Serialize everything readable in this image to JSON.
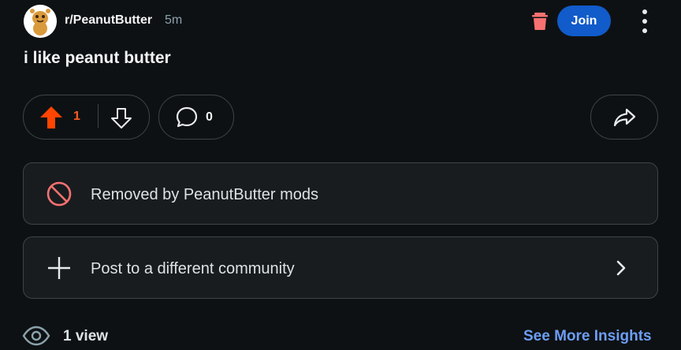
{
  "header": {
    "subreddit": "r/PeanutButter",
    "time": "5m",
    "join_label": "Join",
    "avatar_icon": "peanut-mascot-icon",
    "delete_icon": "trash-icon",
    "more_icon": "vertical-dots-icon"
  },
  "post": {
    "title": "i like peanut butter"
  },
  "actions": {
    "score": "1",
    "comments": "0",
    "upvote_icon": "upvote-arrow-icon",
    "downvote_icon": "downvote-arrow-icon",
    "comment_icon": "comment-bubble-icon",
    "share_icon": "share-arrow-icon"
  },
  "cards": {
    "removed": "Removed by PeanutButter mods",
    "crosspost": "Post to a different community"
  },
  "footer": {
    "views": "1 view",
    "insights_link": "See More Insights"
  },
  "colors": {
    "background": "#0e1113",
    "upvote_active": "#ff4500",
    "join_button": "#115bca",
    "link": "#6c9ef5",
    "removed_icon": "#f87171"
  }
}
